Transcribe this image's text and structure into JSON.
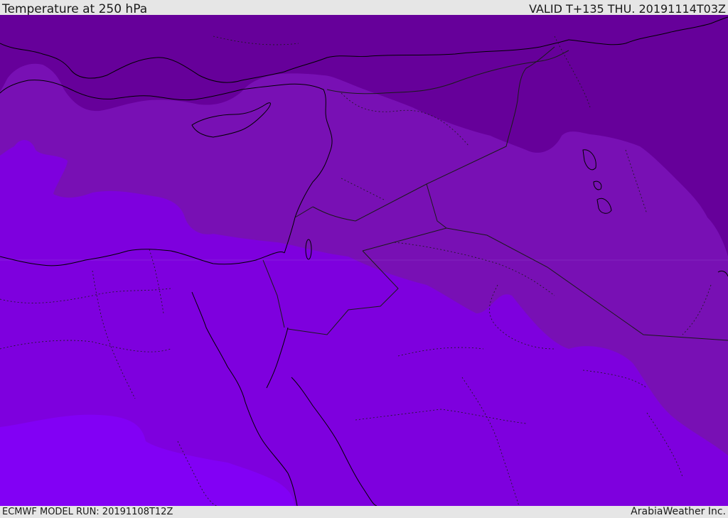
{
  "header": {
    "title": "Temperature at 250 hPa",
    "valid": "VALID T+135 THU. 20191114T03Z"
  },
  "footer": {
    "model_run": "ECMWF MODEL RUN: 20191108T12Z",
    "credit": "ArabiaWeather Inc."
  },
  "colors": {
    "band_coldest": "#66009a",
    "band_cold": "#7810b4",
    "band_mid": "#7e00de",
    "band_warm": "#8200f5",
    "coastline": "#000000",
    "border": "#1a1a1a"
  }
}
